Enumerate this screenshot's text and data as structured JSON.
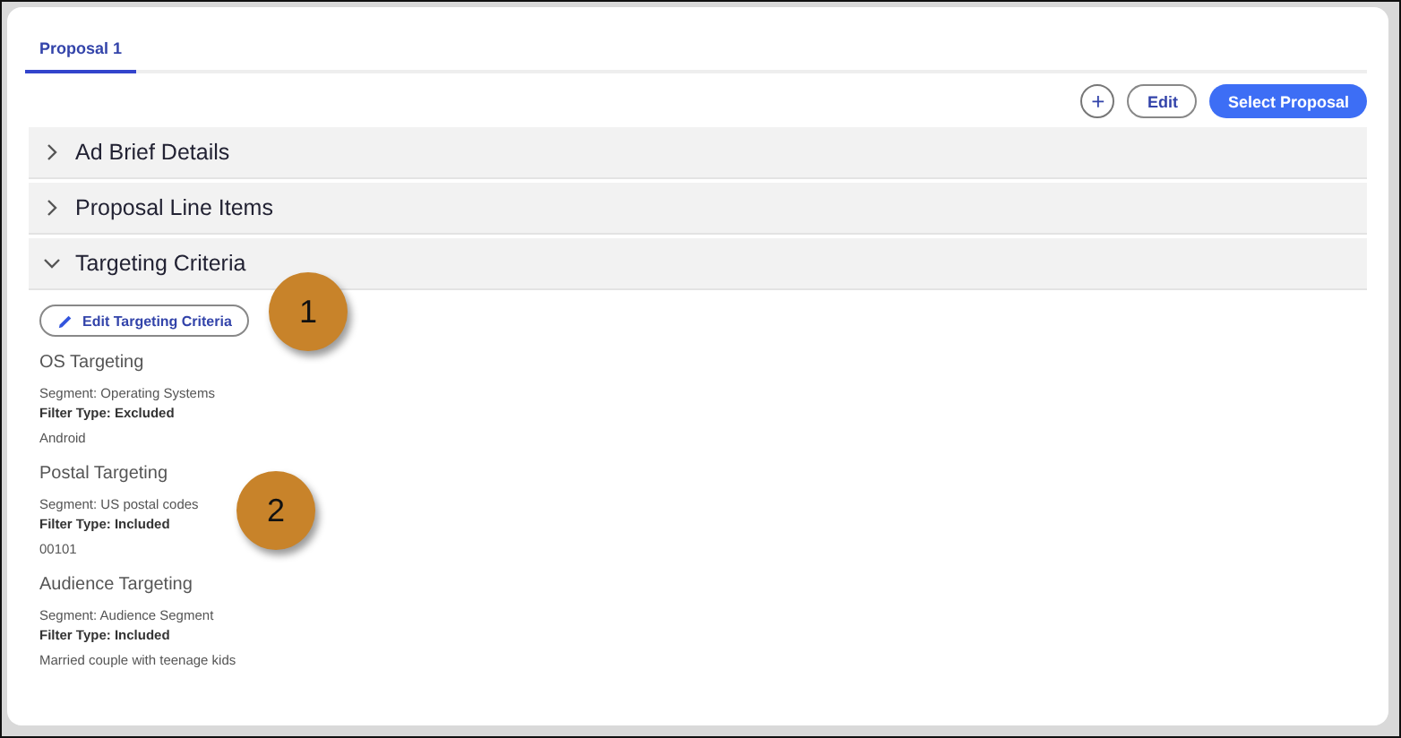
{
  "tabs": [
    {
      "label": "Proposal 1",
      "selected": true
    }
  ],
  "actions": {
    "add": "+",
    "edit": "Edit",
    "select": "Select Proposal"
  },
  "sections": [
    {
      "title": "Ad Brief Details",
      "expanded": false
    },
    {
      "title": "Proposal Line Items",
      "expanded": false
    },
    {
      "title": "Targeting Criteria",
      "expanded": true
    }
  ],
  "edit_targeting_button": "Edit Targeting Criteria",
  "targeting": [
    {
      "title": "OS Targeting",
      "segment": "Segment: Operating Systems",
      "filter_type": "Filter Type: Excluded",
      "value": "Android"
    },
    {
      "title": "Postal Targeting",
      "segment": "Segment: US postal codes",
      "filter_type": "Filter Type: Included",
      "value": "00101"
    },
    {
      "title": "Audience Targeting",
      "segment": "Segment: Audience Segment",
      "filter_type": "Filter Type: Included",
      "value": "Married couple with teenage kids"
    }
  ],
  "callouts": [
    "1",
    "2"
  ]
}
